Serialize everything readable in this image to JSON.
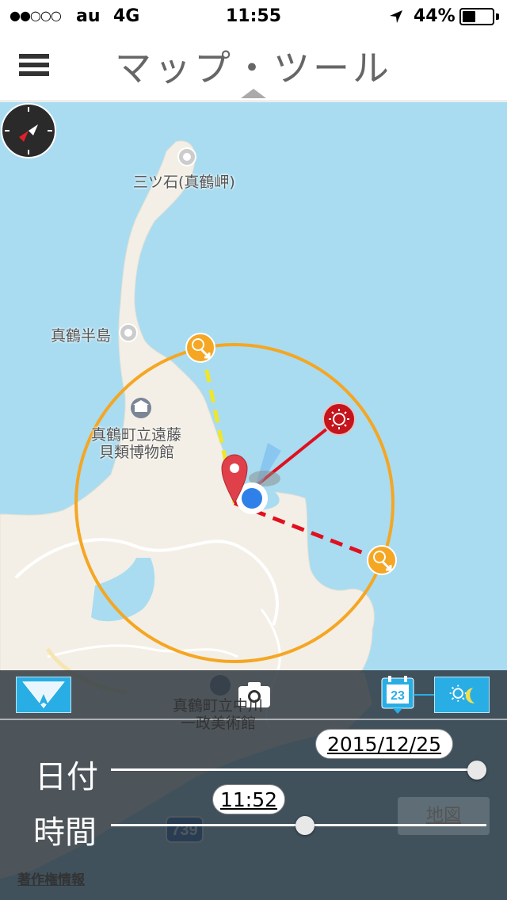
{
  "status_bar": {
    "signal": "●●○○○",
    "carrier": "au",
    "network": "4G",
    "time": "11:55",
    "battery_percent": "44%",
    "battery_level": 0.44,
    "location_icon": "location-arrow-icon"
  },
  "nav": {
    "title": "マップ・ツール",
    "menu_icon": "hamburger-menu-icon"
  },
  "map": {
    "labels": {
      "mitsuishi": "三ツ石(真鶴岬)",
      "manazuru_hanto": "真鶴半島",
      "museum_line1": "真鶴町立遠藤",
      "museum_line2": "貝類博物館",
      "art_museum_line1": "真鶴町立中川",
      "art_museum_line2": "一政美術館",
      "route_number": "739"
    },
    "colors": {
      "sea": "#a9dcf0",
      "land": "#f3efe6",
      "circle": "#f5a623",
      "sun_line": "#e0101e",
      "sunrise_line": "#f0e62a"
    }
  },
  "controls": {
    "date_label": "日付",
    "date_value": "2015/12/25",
    "date_position": 1.0,
    "time_label": "時間",
    "time_value": "11:52",
    "time_position": 0.49,
    "map_button": "地図",
    "copyright": "著作権情報",
    "calendar_day": "23"
  }
}
